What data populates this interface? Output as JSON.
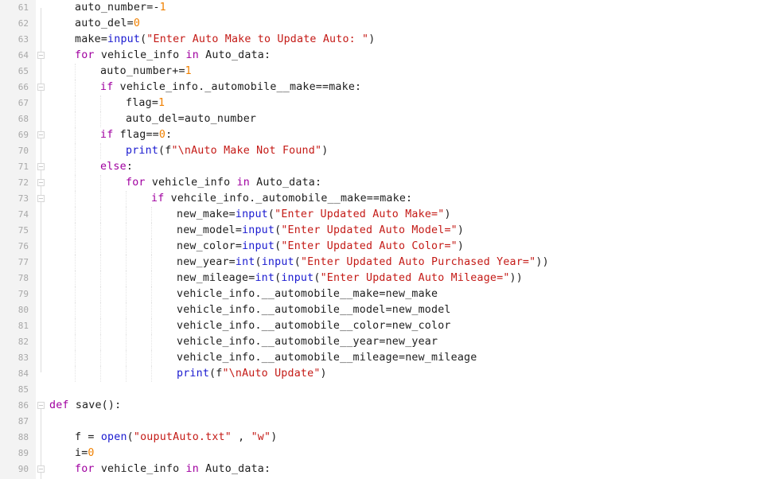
{
  "editor": {
    "language": "python",
    "colors": {
      "keyword": "#a000a0",
      "builtin": "#1a1ad0",
      "string": "#c41a16",
      "number": "#f08000",
      "text": "#1e1e1e",
      "line_number": "#a8a8a8",
      "gutter_bg": "#f3f3f3"
    },
    "lines": [
      {
        "n": "61",
        "indent": 1,
        "fold": false,
        "tokens": [
          [
            "t",
            "auto_number=-"
          ],
          [
            "num",
            "1"
          ]
        ]
      },
      {
        "n": "62",
        "indent": 1,
        "fold": false,
        "tokens": [
          [
            "t",
            "auto_del="
          ],
          [
            "num",
            "0"
          ]
        ]
      },
      {
        "n": "63",
        "indent": 1,
        "fold": false,
        "tokens": [
          [
            "t",
            "make="
          ],
          [
            "bi",
            "input"
          ],
          [
            "t",
            "("
          ],
          [
            "str",
            "\"Enter Auto Make to Update Auto: \""
          ],
          [
            "t",
            ")"
          ]
        ]
      },
      {
        "n": "64",
        "indent": 1,
        "fold": true,
        "tokens": [
          [
            "kw",
            "for"
          ],
          [
            "t",
            " vehicle_info "
          ],
          [
            "kw",
            "in"
          ],
          [
            "t",
            " Auto_data:"
          ]
        ]
      },
      {
        "n": "65",
        "indent": 2,
        "fold": false,
        "tokens": [
          [
            "t",
            "auto_number+="
          ],
          [
            "num",
            "1"
          ]
        ]
      },
      {
        "n": "66",
        "indent": 2,
        "fold": true,
        "tokens": [
          [
            "kw",
            "if"
          ],
          [
            "t",
            " vehicle_info._automobile__make==make:"
          ]
        ]
      },
      {
        "n": "67",
        "indent": 3,
        "fold": false,
        "tokens": [
          [
            "t",
            "flag="
          ],
          [
            "num",
            "1"
          ]
        ]
      },
      {
        "n": "68",
        "indent": 3,
        "fold": false,
        "tokens": [
          [
            "t",
            "auto_del=auto_number"
          ]
        ]
      },
      {
        "n": "69",
        "indent": 2,
        "fold": true,
        "tokens": [
          [
            "kw",
            "if"
          ],
          [
            "t",
            " flag=="
          ],
          [
            "num",
            "0"
          ],
          [
            "t",
            ":"
          ]
        ]
      },
      {
        "n": "70",
        "indent": 3,
        "fold": false,
        "tokens": [
          [
            "bi",
            "print"
          ],
          [
            "t",
            "(f"
          ],
          [
            "str",
            "\"\\nAuto Make Not Found\""
          ],
          [
            "t",
            ")"
          ]
        ]
      },
      {
        "n": "71",
        "indent": 2,
        "fold": true,
        "tokens": [
          [
            "kw",
            "else"
          ],
          [
            "t",
            ":"
          ]
        ]
      },
      {
        "n": "72",
        "indent": 3,
        "fold": true,
        "tokens": [
          [
            "kw",
            "for"
          ],
          [
            "t",
            " vehicle_info "
          ],
          [
            "kw",
            "in"
          ],
          [
            "t",
            " Auto_data:"
          ]
        ]
      },
      {
        "n": "73",
        "indent": 4,
        "fold": true,
        "tokens": [
          [
            "kw",
            "if"
          ],
          [
            "t",
            " vehcile_info._automobile__make==make:"
          ]
        ]
      },
      {
        "n": "74",
        "indent": 5,
        "fold": false,
        "tokens": [
          [
            "t",
            "new_make="
          ],
          [
            "bi",
            "input"
          ],
          [
            "t",
            "("
          ],
          [
            "str",
            "\"Enter Updated Auto Make=\""
          ],
          [
            "t",
            ")"
          ]
        ]
      },
      {
        "n": "75",
        "indent": 5,
        "fold": false,
        "tokens": [
          [
            "t",
            "new_model="
          ],
          [
            "bi",
            "input"
          ],
          [
            "t",
            "("
          ],
          [
            "str",
            "\"Enter Updated Auto Model=\""
          ],
          [
            "t",
            ")"
          ]
        ]
      },
      {
        "n": "76",
        "indent": 5,
        "fold": false,
        "tokens": [
          [
            "t",
            "new_color="
          ],
          [
            "bi",
            "input"
          ],
          [
            "t",
            "("
          ],
          [
            "str",
            "\"Enter Updated Auto Color=\""
          ],
          [
            "t",
            ")"
          ]
        ]
      },
      {
        "n": "77",
        "indent": 5,
        "fold": false,
        "tokens": [
          [
            "t",
            "new_year="
          ],
          [
            "bi",
            "int"
          ],
          [
            "t",
            "("
          ],
          [
            "bi",
            "input"
          ],
          [
            "t",
            "("
          ],
          [
            "str",
            "\"Enter Updated Auto Purchased Year=\""
          ],
          [
            "t",
            "))"
          ]
        ]
      },
      {
        "n": "78",
        "indent": 5,
        "fold": false,
        "tokens": [
          [
            "t",
            "new_mileage="
          ],
          [
            "bi",
            "int"
          ],
          [
            "t",
            "("
          ],
          [
            "bi",
            "input"
          ],
          [
            "t",
            "("
          ],
          [
            "str",
            "\"Enter Updated Auto Mileage=\""
          ],
          [
            "t",
            "))"
          ]
        ]
      },
      {
        "n": "79",
        "indent": 5,
        "fold": false,
        "tokens": [
          [
            "t",
            "vehicle_info.__automobile__make=new_make"
          ]
        ]
      },
      {
        "n": "80",
        "indent": 5,
        "fold": false,
        "tokens": [
          [
            "t",
            "vehicle_info.__automobile__model=new_model"
          ]
        ]
      },
      {
        "n": "81",
        "indent": 5,
        "fold": false,
        "tokens": [
          [
            "t",
            "vehicle_info.__automobile__color=new_color"
          ]
        ]
      },
      {
        "n": "82",
        "indent": 5,
        "fold": false,
        "tokens": [
          [
            "t",
            "vehicle_info.__automobile__year=new_year"
          ]
        ]
      },
      {
        "n": "83",
        "indent": 5,
        "fold": false,
        "tokens": [
          [
            "t",
            "vehicle_info.__automobile__mileage=new_mileage"
          ]
        ]
      },
      {
        "n": "84",
        "indent": 5,
        "fold": false,
        "tokens": [
          [
            "bi",
            "print"
          ],
          [
            "t",
            "(f"
          ],
          [
            "str",
            "\"\\nAuto Update\""
          ],
          [
            "t",
            ")"
          ]
        ]
      },
      {
        "n": "85",
        "indent": 0,
        "fold": false,
        "tokens": []
      },
      {
        "n": "86",
        "indent": 0,
        "fold": true,
        "tokens": [
          [
            "kw",
            "def"
          ],
          [
            "t",
            " save():"
          ]
        ]
      },
      {
        "n": "87",
        "indent": 0,
        "fold": false,
        "tokens": []
      },
      {
        "n": "88",
        "indent": 1,
        "fold": false,
        "tokens": [
          [
            "t",
            "f = "
          ],
          [
            "bi",
            "open"
          ],
          [
            "t",
            "("
          ],
          [
            "str",
            "\"ouputAuto.txt\""
          ],
          [
            "t",
            " , "
          ],
          [
            "str",
            "\"w\""
          ],
          [
            "t",
            ")"
          ]
        ]
      },
      {
        "n": "89",
        "indent": 1,
        "fold": false,
        "tokens": [
          [
            "t",
            "i="
          ],
          [
            "num",
            "0"
          ]
        ]
      },
      {
        "n": "90",
        "indent": 1,
        "fold": true,
        "tokens": [
          [
            "kw",
            "for"
          ],
          [
            "t",
            " vehicle_info "
          ],
          [
            "kw",
            "in"
          ],
          [
            "t",
            " Auto_data:"
          ]
        ]
      }
    ]
  }
}
